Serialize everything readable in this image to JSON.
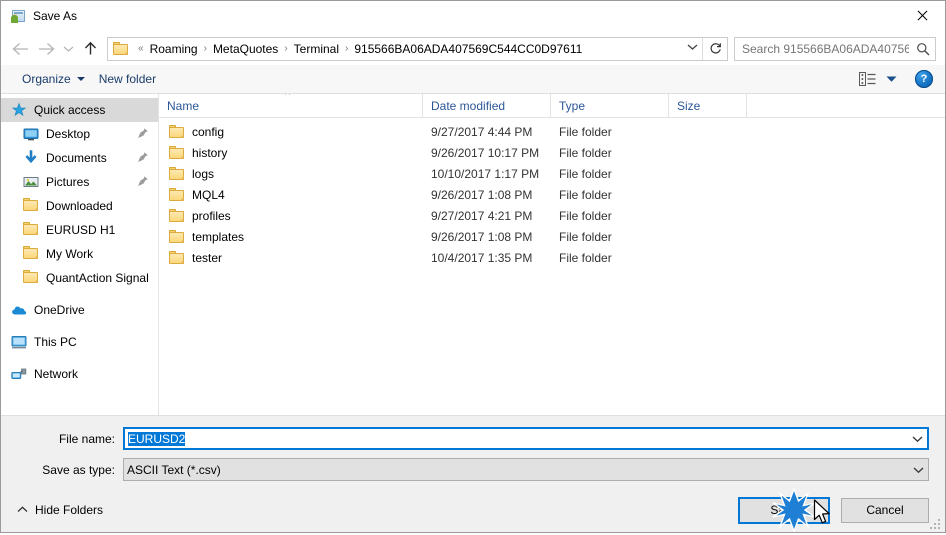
{
  "window": {
    "title": "Save As",
    "title_icon": "save-as-app-icon",
    "close_icon": "close-icon"
  },
  "nav": {
    "back_icon": "back-arrow-icon",
    "forward_icon": "forward-arrow-icon",
    "recent_icon": "recent-locations-chevron-icon",
    "up_icon": "up-arrow-icon",
    "folder_icon": "folder-icon",
    "breadcrumb_prefix": "«",
    "breadcrumbs": [
      "Roaming",
      "MetaQuotes",
      "Terminal",
      "915566BA06ADA407569C544CC0D97611"
    ],
    "breadcrumb_separator": "›",
    "dropdown_icon": "chevron-down-icon",
    "refresh_icon": "refresh-icon"
  },
  "search": {
    "placeholder": "Search 915566BA06ADA40756...",
    "value": "",
    "icon": "search-icon"
  },
  "toolbar": {
    "organize_label": "Organize",
    "new_folder_label": "New folder",
    "view_icon": "view-options-icon",
    "view_dropdown_icon": "chevron-down-icon",
    "help_label": "?",
    "help_icon": "help-icon"
  },
  "sidebar": {
    "items": [
      {
        "label": "Quick access",
        "icon": "star-icon",
        "selected": true,
        "indent": false,
        "pinned": false,
        "gap_before": false
      },
      {
        "label": "Desktop",
        "icon": "desktop-icon",
        "selected": false,
        "indent": true,
        "pinned": true,
        "gap_before": false
      },
      {
        "label": "Documents",
        "icon": "documents-download-icon",
        "selected": false,
        "indent": true,
        "pinned": true,
        "gap_before": false
      },
      {
        "label": "Pictures",
        "icon": "pictures-icon",
        "selected": false,
        "indent": true,
        "pinned": true,
        "gap_before": false
      },
      {
        "label": "Downloaded",
        "icon": "folder-icon",
        "selected": false,
        "indent": true,
        "pinned": false,
        "gap_before": false
      },
      {
        "label": "EURUSD H1",
        "icon": "folder-icon",
        "selected": false,
        "indent": true,
        "pinned": false,
        "gap_before": false
      },
      {
        "label": "My Work",
        "icon": "folder-icon",
        "selected": false,
        "indent": true,
        "pinned": false,
        "gap_before": false
      },
      {
        "label": "QuantAction Signal",
        "icon": "folder-icon",
        "selected": false,
        "indent": true,
        "pinned": false,
        "gap_before": false
      },
      {
        "label": "OneDrive",
        "icon": "onedrive-cloud-icon",
        "selected": false,
        "indent": false,
        "pinned": false,
        "gap_before": true
      },
      {
        "label": "This PC",
        "icon": "this-pc-monitor-icon",
        "selected": false,
        "indent": false,
        "pinned": false,
        "gap_before": true
      },
      {
        "label": "Network",
        "icon": "network-icon",
        "selected": false,
        "indent": false,
        "pinned": false,
        "gap_before": true
      }
    ],
    "pin_icon": "pin-icon"
  },
  "filelist": {
    "columns": [
      "Name",
      "Date modified",
      "Type",
      "Size"
    ],
    "sort_column": "Name",
    "sort_direction": "ascending",
    "sort_icon": "sort-ascending-caret-icon",
    "rows": [
      {
        "name": "config",
        "date": "9/27/2017 4:44 PM",
        "type": "File folder",
        "size": "",
        "icon": "folder-icon"
      },
      {
        "name": "history",
        "date": "9/26/2017 10:17 PM",
        "type": "File folder",
        "size": "",
        "icon": "folder-icon"
      },
      {
        "name": "logs",
        "date": "10/10/2017 1:17 PM",
        "type": "File folder",
        "size": "",
        "icon": "folder-icon"
      },
      {
        "name": "MQL4",
        "date": "9/26/2017 1:08 PM",
        "type": "File folder",
        "size": "",
        "icon": "folder-icon"
      },
      {
        "name": "profiles",
        "date": "9/27/2017 4:21 PM",
        "type": "File folder",
        "size": "",
        "icon": "folder-icon"
      },
      {
        "name": "templates",
        "date": "9/26/2017 1:08 PM",
        "type": "File folder",
        "size": "",
        "icon": "folder-icon"
      },
      {
        "name": "tester",
        "date": "10/4/2017 1:35 PM",
        "type": "File folder",
        "size": "",
        "icon": "folder-icon"
      }
    ]
  },
  "form": {
    "filename_label": "File name:",
    "filename_value": "EURUSD2",
    "filename_selected": true,
    "filetype_label": "Save as type:",
    "filetype_value": "ASCII Text (*.csv)",
    "dropdown_icon": "chevron-down-icon"
  },
  "footer": {
    "hide_folders_label": "Hide Folders",
    "hide_folders_icon": "chevron-up-icon",
    "save_label": "Save",
    "cancel_label": "Cancel",
    "resize_grip_icon": "resize-grip-icon",
    "cursor_icon": "mouse-pointer-icon",
    "click_burst_icon": "click-burst-icon"
  },
  "colors": {
    "accent": "#0078d7",
    "column_header_text": "#2b5797",
    "toolbar_link": "#1a3c6b",
    "selection": "#d9d9d9",
    "folder_yellow": "#fcd87c",
    "dialog_chrome": "#f0f0f0"
  }
}
